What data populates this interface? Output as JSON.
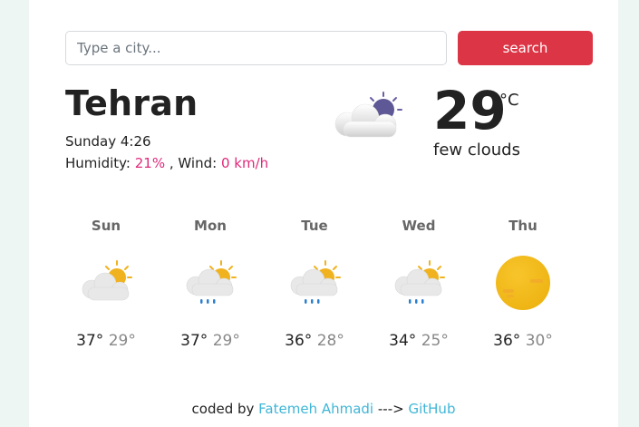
{
  "search": {
    "placeholder": "Type a city...",
    "button_label": "search"
  },
  "current": {
    "city": "Tehran",
    "datetime": "Sunday 4:26",
    "humidity_label": "Humidity:",
    "humidity_value": "21%",
    "separator": " , ",
    "wind_label": "Wind:",
    "wind_value": "0 km/h",
    "temperature": "29",
    "unit": "°C",
    "description": "few clouds",
    "icon": "few-clouds-night-icon"
  },
  "forecast": [
    {
      "day": "Sun",
      "max": "37°",
      "min": "29°",
      "icon": "partly-cloudy-icon"
    },
    {
      "day": "Mon",
      "max": "37°",
      "min": "29°",
      "icon": "cloud-sun-rain-icon"
    },
    {
      "day": "Tue",
      "max": "36°",
      "min": "28°",
      "icon": "cloud-sun-rain-icon"
    },
    {
      "day": "Wed",
      "max": "34°",
      "min": "25°",
      "icon": "cloud-sun-rain-icon"
    },
    {
      "day": "Thu",
      "max": "36°",
      "min": "30°",
      "icon": "sun-icon"
    }
  ],
  "footer": {
    "prefix": "coded by",
    "author": "Fatemeh Ahmadi",
    "arrow": "--->",
    "github": "GitHub"
  },
  "colors": {
    "accent": "#dc3545",
    "highlight": "#e0297a",
    "link": "#3fb6d7"
  }
}
